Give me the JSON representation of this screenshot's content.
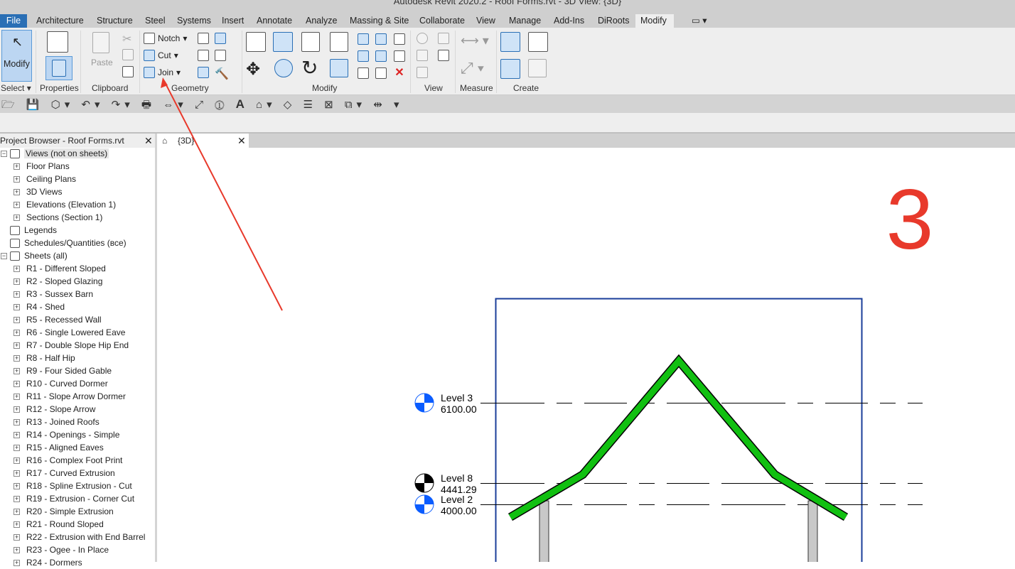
{
  "window": {
    "title": "Autodesk Revit 2020.2 - Roof Forms.rvt - 3D View: {3D}"
  },
  "tabs": [
    "File",
    "Architecture",
    "Structure",
    "Steel",
    "Systems",
    "Insert",
    "Annotate",
    "Analyze",
    "Massing & Site",
    "Collaborate",
    "View",
    "Manage",
    "Add-Ins",
    "DiRoots",
    "Modify"
  ],
  "active_tab": "Modify",
  "ribbon": {
    "select": {
      "modify": "Modify",
      "label": "Select"
    },
    "properties": {
      "label": "Properties"
    },
    "clipboard": {
      "paste": "Paste",
      "label": "Clipboard"
    },
    "geometry": {
      "notch": "Notch",
      "cut": "Cut",
      "join": "Join",
      "label": "Geometry"
    },
    "modify": {
      "label": "Modify"
    },
    "view": {
      "label": "View"
    },
    "measure": {
      "label": "Measure"
    },
    "create": {
      "label": "Create"
    }
  },
  "browser": {
    "title": "Project Browser - Roof Forms.rvt",
    "items": [
      {
        "label": "Views (not on sheets)",
        "level": 0,
        "toggle": "−",
        "icon": "view"
      },
      {
        "label": "Floor Plans",
        "level": 1,
        "toggle": "+"
      },
      {
        "label": "Ceiling Plans",
        "level": 1,
        "toggle": "+"
      },
      {
        "label": "3D Views",
        "level": 1,
        "toggle": "+"
      },
      {
        "label": "Elevations (Elevation 1)",
        "level": 1,
        "toggle": "+"
      },
      {
        "label": "Sections (Section 1)",
        "level": 1,
        "toggle": "+"
      },
      {
        "label": "Legends",
        "level": 0,
        "toggle": "",
        "icon": "legend"
      },
      {
        "label": "Schedules/Quantities (все)",
        "level": 0,
        "toggle": "",
        "icon": "schedule"
      },
      {
        "label": "Sheets (all)",
        "level": 0,
        "toggle": "−",
        "icon": "sheet"
      },
      {
        "label": "R1 - Different Sloped",
        "level": 1,
        "toggle": "+"
      },
      {
        "label": "R2 - Sloped Glazing",
        "level": 1,
        "toggle": "+"
      },
      {
        "label": "R3 - Sussex Barn",
        "level": 1,
        "toggle": "+"
      },
      {
        "label": "R4 - Shed",
        "level": 1,
        "toggle": "+"
      },
      {
        "label": "R5 - Recessed Wall",
        "level": 1,
        "toggle": "+"
      },
      {
        "label": "R6 - Single Lowered Eave",
        "level": 1,
        "toggle": "+"
      },
      {
        "label": "R7 - Double Slope Hip End",
        "level": 1,
        "toggle": "+"
      },
      {
        "label": "R8 - Half Hip",
        "level": 1,
        "toggle": "+"
      },
      {
        "label": "R9 - Four Sided Gable",
        "level": 1,
        "toggle": "+"
      },
      {
        "label": "R10 - Curved Dormer",
        "level": 1,
        "toggle": "+"
      },
      {
        "label": "R11 - Slope Arrow Dormer",
        "level": 1,
        "toggle": "+"
      },
      {
        "label": "R12 - Slope Arrow",
        "level": 1,
        "toggle": "+"
      },
      {
        "label": "R13 - Joined Roofs",
        "level": 1,
        "toggle": "+"
      },
      {
        "label": "R14 - Openings - Simple",
        "level": 1,
        "toggle": "+"
      },
      {
        "label": "R15 - Aligned Eaves",
        "level": 1,
        "toggle": "+"
      },
      {
        "label": "R16 - Complex Foot Print",
        "level": 1,
        "toggle": "+"
      },
      {
        "label": "R17 - Curved Extrusion",
        "level": 1,
        "toggle": "+"
      },
      {
        "label": "R18 - Spline Extrusion - Cut",
        "level": 1,
        "toggle": "+"
      },
      {
        "label": "R19 - Extrusion - Corner Cut",
        "level": 1,
        "toggle": "+"
      },
      {
        "label": "R20 - Simple Extrusion",
        "level": 1,
        "toggle": "+"
      },
      {
        "label": "R21 - Round Sloped",
        "level": 1,
        "toggle": "+"
      },
      {
        "label": "R22 - Extrusion with End Barrel",
        "level": 1,
        "toggle": "+"
      },
      {
        "label": "R23 - Ogee - In Place",
        "level": 1,
        "toggle": "+"
      },
      {
        "label": "R24 - Dormers",
        "level": 1,
        "toggle": "+"
      }
    ]
  },
  "view_tab": {
    "label": "{3D}"
  },
  "levels": [
    {
      "name": "Level 3",
      "elevation": "6100.00",
      "color": "#0a5cff"
    },
    {
      "name": "Level 8",
      "elevation": "4441.29",
      "color": "#000000"
    },
    {
      "name": "Level 2",
      "elevation": "4000.00",
      "color": "#0a5cff"
    }
  ],
  "annotation": {
    "step_number": "3",
    "color": "#e8392b"
  },
  "colors": {
    "roof": "#11c011",
    "accent": "#2a6fb5"
  }
}
